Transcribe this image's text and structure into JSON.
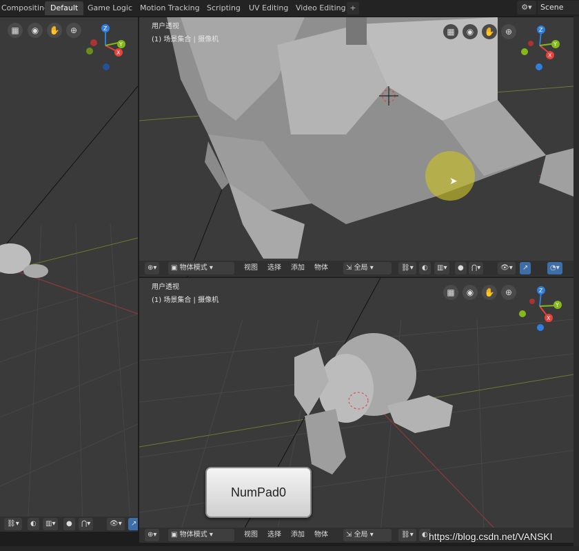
{
  "topbar": {
    "tabs": [
      {
        "label": "Compositing"
      },
      {
        "label": "Default"
      },
      {
        "label": "Game Logic"
      },
      {
        "label": "Motion Tracking"
      },
      {
        "label": "Scripting"
      },
      {
        "label": "UV Editing"
      },
      {
        "label": "Video Editing"
      }
    ],
    "add_tab": "+",
    "scene_name": "Scene"
  },
  "viewport_top": {
    "title": "用户透视",
    "collection": "(1) 场景集合 | 摄像机"
  },
  "viewport_bottom": {
    "title": "用户透视",
    "collection": "(1) 场景集合 | 摄像机"
  },
  "header": {
    "mode": "物体模式",
    "menus": [
      "视图",
      "选择",
      "添加",
      "物体"
    ],
    "transform": "全局"
  },
  "gizmo": {
    "x": "X",
    "y": "Y",
    "z": "Z"
  },
  "key_overlay": "NumPad0",
  "watermark": "https://blog.csdn.net/VANSKI",
  "colors": {
    "x_axis": "#e8423a",
    "y_axis": "#84b81b",
    "z_axis": "#2f7fe0",
    "active_tab": "#3d3d3d"
  }
}
